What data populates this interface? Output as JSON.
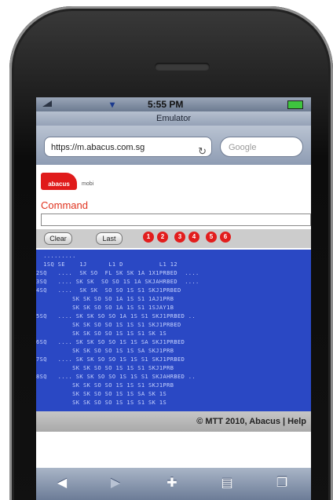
{
  "status": {
    "time": "5:55 PM"
  },
  "browser": {
    "title": "Emulator",
    "url": "https://m.abacus.com.sg",
    "search_placeholder": "Google"
  },
  "page": {
    "logo_text": "abacus",
    "logo_tag": "mobi",
    "command_label": "Command",
    "command_value": "",
    "buttons": {
      "clear": "Clear",
      "last": "Last"
    },
    "function_keys": [
      "1",
      "2",
      "3",
      "4",
      "5",
      "6"
    ],
    "terminal_lines": [
      "  .........",
      "  1SQ SE    1J      L1 D          L1 12",
      "2SQ   ....  SK SO  FL SK SK 1A 1X1PRBED  ....",
      "3SQ   .... SK SK  SO SO 1S 1A SKJAHRBED  ....",
      "4SQ   ....  SK SK  SO SO 1S S1 SKJ1PRBED",
      "          SK SK SO SO 1A 1S S1 1AJ1PRB",
      "          SK SK SO SO 1A 1S S1 1SJAY1B",
      "5SQ   .... SK SK SO SO 1A 1S S1 SKJ1PRBED ..",
      "          SK SK SO SO 1S 1S S1 SKJ1PRBED",
      "          SK SK SO SO 1S 1S S1 SK 1S",
      "6SQ   .... SK SK SO SO 1S 1S SA SKJ1PRBED",
      "          SK SK SO SO 1S 1S SA SKJ1PRB",
      "7SQ   .... SK SK SO SO 1S 1S S1 SKJ1PRBED",
      "          SK SK SO SO 1S 1S S1 SKJ1PRB",
      "8SQ   .... SK SK SO SO 1S 1S S1 SKJAHRBED ..",
      "          SK SK SO SO 1S 1S S1 SKJ1PRB",
      "          SK SK SO SO 1S 1S SA SK 1S",
      "          SK SK SO SO 1S 1S S1 SK 1S"
    ],
    "footer": "© MTT 2010, Abacus | Help"
  },
  "colors": {
    "terminal_bg": "#2a48c4",
    "accent_red": "#e01b1b",
    "command_label": "#e0321e"
  }
}
